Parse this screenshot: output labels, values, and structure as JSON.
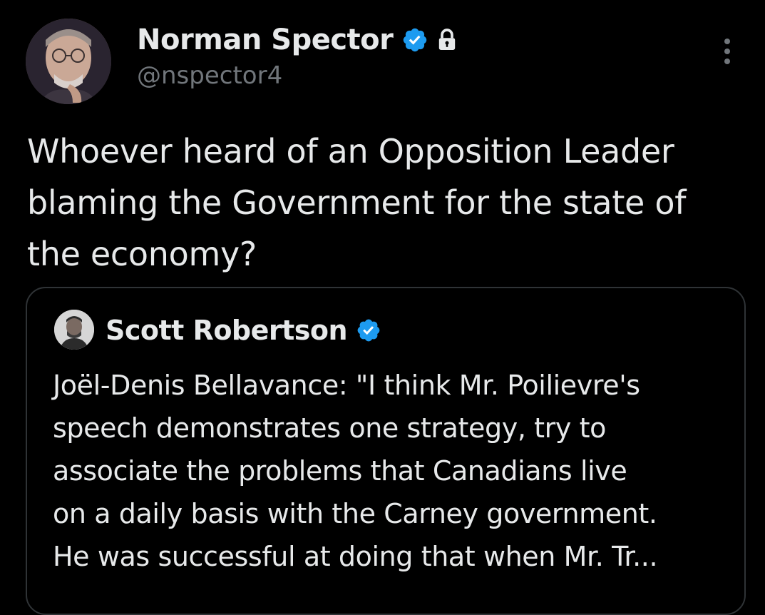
{
  "tweet": {
    "author": {
      "display_name": "Norman Spector",
      "handle": "@nspector4",
      "verified_icon": "verified-badge-icon",
      "protected_icon": "lock-icon"
    },
    "text": "Whoever heard of an Opposition Leader\nblaming the Government for the state of\nthe economy?",
    "menu_icon": "more-vertical-icon"
  },
  "quoted_tweet": {
    "author": {
      "display_name": "Scott Robertson",
      "verified_icon": "verified-badge-icon"
    },
    "text": "Joël-Denis Bellavance: \"I think Mr. Poilievre's\nspeech demonstrates one strategy, try to\nassociate the problems that Canadians live\non a daily basis with the Carney government.\nHe was successful at doing that when Mr. Tr..."
  },
  "colors": {
    "background": "#000000",
    "text_primary": "#e7e9ea",
    "text_secondary": "#71767b",
    "verified_blue": "#1d9bf0",
    "border": "#2f3336"
  }
}
